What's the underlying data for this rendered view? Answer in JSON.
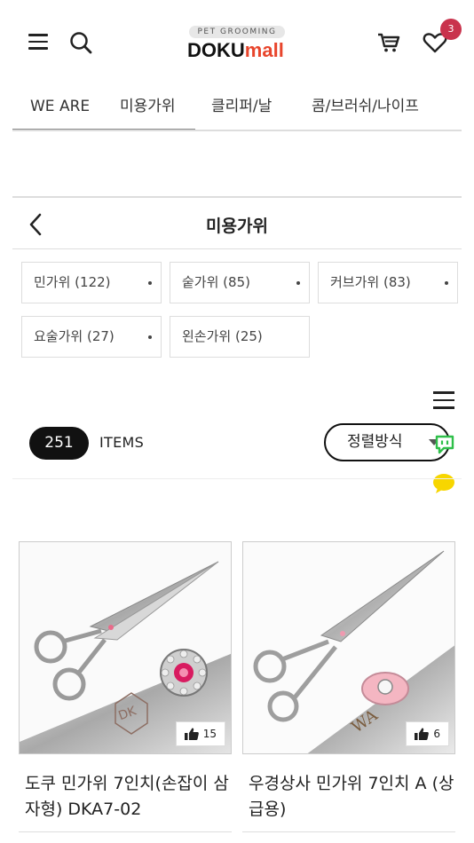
{
  "header": {
    "logo_tag": "PET GROOMING",
    "logo_brand": "DOKU",
    "logo_suffix": "mall",
    "wishlist_count": "3",
    "icons": [
      "menu-icon",
      "search-icon",
      "cart-icon",
      "heart-icon"
    ]
  },
  "category_nav": {
    "tabs": [
      {
        "label": "WE ARE"
      },
      {
        "label": "미용가위"
      },
      {
        "label": "클리퍼/날"
      },
      {
        "label": "콤/브러쉬/나이프"
      }
    ]
  },
  "page": {
    "title": "미용가위"
  },
  "sub_categories": [
    {
      "label": "민가위 (122)",
      "has_more": true
    },
    {
      "label": "숱가위 (85)",
      "has_more": true
    },
    {
      "label": "커브가위 (83)",
      "has_more": true
    },
    {
      "label": "요술가위 (27)",
      "has_more": true
    },
    {
      "label": "왼손가위 (25)",
      "has_more": false
    }
  ],
  "listing": {
    "count": "251",
    "count_label": "ITEMS",
    "sort_label": "정렬방식"
  },
  "products": [
    {
      "name": "도쿠 민가위 7인치(손잡이 삼자형) DKA7-02",
      "likes": "15"
    },
    {
      "name": "우경상사 민가위 7인치 A (상급용)",
      "likes": "6"
    }
  ],
  "colors": {
    "brand_orange": "#e8452c",
    "badge_red": "#c9334d",
    "chat_green": "#2fbf4a",
    "kakao_yellow": "#f7d600"
  }
}
